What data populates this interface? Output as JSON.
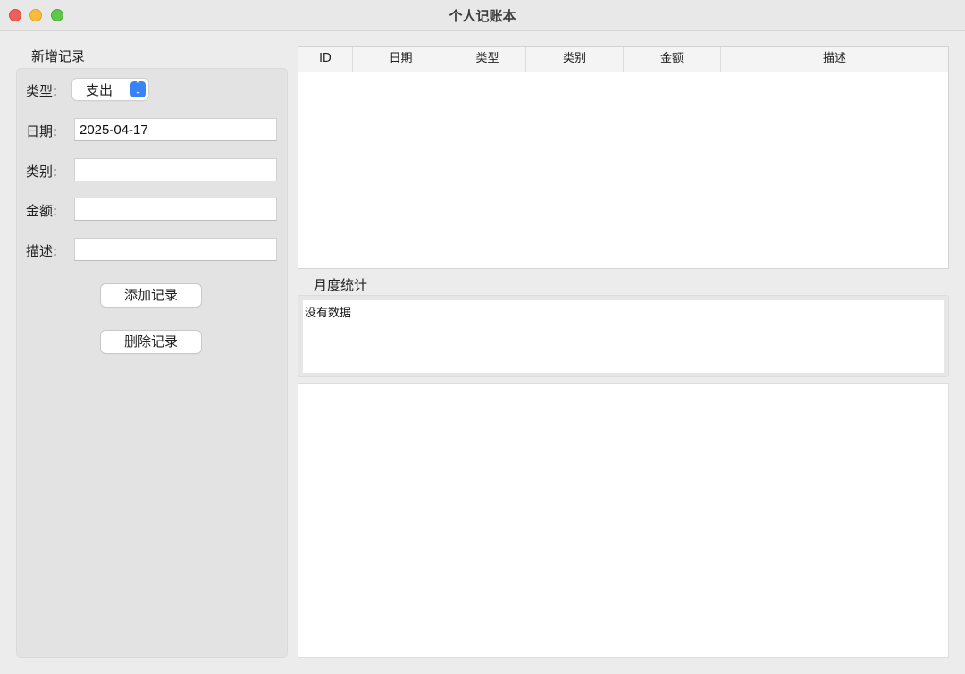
{
  "window": {
    "title": "个人记账本"
  },
  "form": {
    "group_title": "新增记录",
    "type_label": "类型:",
    "type_value": "支出",
    "date_label": "日期:",
    "date_value": "2025-04-17",
    "category_label": "类别:",
    "category_value": "",
    "amount_label": "金额:",
    "amount_value": "",
    "desc_label": "描述:",
    "desc_value": "",
    "add_button": "添加记录",
    "delete_button": "删除记录"
  },
  "table": {
    "columns": [
      "ID",
      "日期",
      "类型",
      "类别",
      "金额",
      "描述"
    ],
    "rows": []
  },
  "stats": {
    "title": "月度统计",
    "text": "没有数据"
  },
  "colors": {
    "accent": "#3a82f7",
    "close": "#ee5f57",
    "minimize": "#f6bd3b",
    "maximize": "#5fc84a"
  }
}
